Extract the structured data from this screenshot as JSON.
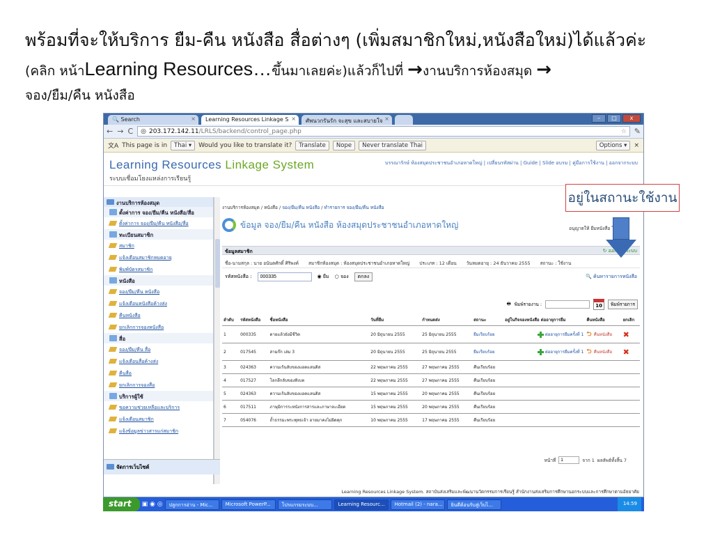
{
  "slide": {
    "line1": "พร้อมที่จะให้บริการ ยืม-คืน หนังสือ สื่อต่างๆ (เพิ่มสมาชิกใหม่,หนังสือใหม่)ได้แล้วค่ะ",
    "line2_a": "(คลิก หน้า",
    "line2_big": "Learning Resources…",
    "line2_b": "ขึ้นมาเลยค่ะ)แล้วก็ไปที่ ",
    "line2_c": "งานบริการห้องสมุด ",
    "line3": "จอง/ยืม/คืน หนังสือ",
    "arrow_glyph": "→"
  },
  "callout": {
    "text": "อยู่ในสถานะใช้งาน",
    "border_color": "#d04040"
  },
  "browser": {
    "tabs": [
      {
        "label": "Search"
      },
      {
        "label": "Learning Resources Linkage S"
      },
      {
        "label": "ศัพนวกรันรัก จะสุข และสบายใจ"
      }
    ],
    "url_host": "203.172.142.11",
    "url_path": "/LRLS/backend/control_page.php",
    "translate": {
      "message": "This page is in",
      "language": "Thai ▾",
      "question": "Would you like to translate it?",
      "translate_btn": "Translate",
      "nope_btn": "Nope",
      "never_btn": "Never translate Thai",
      "options_btn": "Options ▾"
    }
  },
  "app": {
    "title_blue": "Learning Resources ",
    "title_green": "Linkage System",
    "subtitle": "ระบบเชื่อมโยงแหล่งการเรียนรู้",
    "usermenu": "บรรณารักษ์ ห้องสมุดประชาชนอำเภอหาดใหญ่ | เปลี่ยนรหัสผ่าน | Guide | Slide อบรม | คู่มือการใช้งาน | ออกจากระบบ"
  },
  "sidebar": {
    "header": "งานบริการห้องสมุด",
    "items": [
      {
        "type": "sec",
        "label": "ตั้งค่าการ จอง/ยืม/คืน หนังสือ/สื่อ"
      },
      {
        "type": "item",
        "label": "ตั้งค่าการ จอง/ยืม/คืน หนังสือ/สื่อ"
      },
      {
        "type": "sec",
        "label": "ทะเบียนสมาชิก"
      },
      {
        "type": "item",
        "label": "สมาชิก"
      },
      {
        "type": "item",
        "label": "แจ้งเตือนสมาชิกหมดอายุ"
      },
      {
        "type": "item",
        "label": "พิมพ์บัตรสมาชิก"
      },
      {
        "type": "sec",
        "label": "หนังสือ"
      },
      {
        "type": "item",
        "label": "จอง/ยืม/คืน หนังสือ"
      },
      {
        "type": "item",
        "label": "แจ้งเตือนหนังสือค้างส่ง"
      },
      {
        "type": "item",
        "label": "คืนหนังสือ"
      },
      {
        "type": "item",
        "label": "ยกเลิกการจองหนังสือ"
      },
      {
        "type": "sec",
        "label": "สื่อ"
      },
      {
        "type": "item",
        "label": "จอง/ยืม/คืน สื่อ"
      },
      {
        "type": "item",
        "label": "แจ้งเตือนสื่อค้างส่ง"
      },
      {
        "type": "item",
        "label": "คืนสื่อ"
      },
      {
        "type": "item",
        "label": "ยกเลิกการจองสื่อ"
      },
      {
        "type": "sec",
        "label": "บริการผู้ใช้"
      },
      {
        "type": "item",
        "label": "ขอความช่วยเหลือและบริการ"
      },
      {
        "type": "item",
        "label": "แจ้งเตือนสมาชิก"
      },
      {
        "type": "item",
        "label": "แจ้งข้อมูลข่าวสารแก่สมาชิก"
      }
    ],
    "footer": "จัดการเว็บไซต์"
  },
  "main": {
    "crumb_prefix": "งานบริการห้องสมุด / หนังสือ / ",
    "crumb_link1": "จอง/ยืม/คืน หนังสือ",
    "crumb_sep": " / ",
    "crumb_link2": "ทำรายการ จอง/ยืม/คืน หนังสือ",
    "panel_title": "ข้อมูล จอง/ยืม/คืน หนังสือ ห้องสมุดประชาชนอำเภอหาดใหญ่",
    "right_note": "อนุญาตให้ ยืมหนังสือ ได้ไม่เกิน",
    "member_bar": "ข้อมูลสมาชิก",
    "logout": "ออกจากระบบ",
    "info": {
      "name": "ชื่อ-นามสกุล :  นาย อนันตศักดิ์ ศิริพงค์",
      "member": "สมาชิกห้องสมุด : ห้องสมุดประชาชนอำเภอหาดใหญ่",
      "type": "ประเภท : 12 เดือน",
      "expire": "วันหมดอายุ : 24 ธันวาคม 2555",
      "status": "สถานะ : ใช้งาน"
    },
    "search": {
      "label": "รหัสหนังสือ :",
      "value": "000335",
      "opt_borrow": "ยืม",
      "opt_reserve": "จอง",
      "button": "ตกลง",
      "find_books": "ค้นหารายการหนังสือ"
    },
    "print": {
      "label": "พิมพ์รายงาน :",
      "cal": "10",
      "button": "พิมพ์รายการ"
    },
    "table": {
      "headers": [
        "ลำดับ",
        "รหัสหนังสือ",
        "ชื่อหนังสือ",
        "วันที่ยืม",
        "กำหนดส่ง",
        "สถานะ",
        "อยู่ในกิจจองหนังสือ ต่ออายุการยืม",
        "คืนหนังสือ",
        "ยกเลิก"
      ],
      "rows": [
        {
          "no": "1",
          "code": "000335",
          "title": "ตายแล้วยังมีชีวิต",
          "borrow": "20 มิถุนายน 2555",
          "due": "25 มิถุนายน 2555",
          "status": "ยืมเรียบร้อย",
          "renew": "ต่ออายุการยืมครั้งที่ 1",
          "ret": "คืนหนังสือ",
          "del": "✖"
        },
        {
          "no": "2",
          "code": "017545",
          "title": "สามก๊ก เล่ม 3",
          "borrow": "20 มิถุนายน 2555",
          "due": "25 มิถุนายน 2555",
          "status": "ยืมเรียบร้อย",
          "renew": "ต่ออายุการยืมครั้งที่ 1",
          "ret": "คืนหนังสือ",
          "del": "✖"
        },
        {
          "no": "3",
          "code": "024363",
          "title": "ความเร้นลับของแอตแลนติส",
          "borrow": "22 พฤษภาคม 2555",
          "due": "27 พฤษภาคม 2555",
          "status": "คืนเรียบร้อย",
          "renew": "",
          "ret": "",
          "del": ""
        },
        {
          "no": "4",
          "code": "017527",
          "title": "โลกลึกลับของทิเบต",
          "borrow": "22 พฤษภาคม 2555",
          "due": "27 พฤษภาคม 2555",
          "status": "คืนเรียบร้อย",
          "renew": "",
          "ret": "",
          "del": ""
        },
        {
          "no": "5",
          "code": "024363",
          "title": "ความเร้นลับของแอตแลนติส",
          "borrow": "15 พฤษภาคม 2555",
          "due": "20 พฤษภาคม 2555",
          "status": "คืนเรียบร้อย",
          "renew": "",
          "ret": "",
          "del": ""
        },
        {
          "no": "6",
          "code": "017511",
          "title": "ภาษุมิการระหนังการสารและภาษาละเอียด",
          "borrow": "15 พฤษภาคม 2555",
          "due": "20 พฤษภาคม 2555",
          "status": "คืนเรียบร้อย",
          "renew": "",
          "ret": "",
          "del": ""
        },
        {
          "no": "7",
          "code": "054076",
          "title": "ถ้ำธรรมะพระพุทธเจ้า อายมาคงไม่ผิดคุก",
          "borrow": "10 พฤษภาคม 2555",
          "due": "17 พฤษภาคม 2555",
          "status": "คืนเรียบร้อย",
          "renew": "",
          "ret": "",
          "del": ""
        }
      ]
    },
    "paging": {
      "label": "หน้าที่",
      "page": "1",
      "of": "จาก 1",
      "total": "ผลลัพธ์ทั้งสิ้น 7"
    }
  },
  "footer": "Learning Resources Linkage System. สถาบันส่งเสริมและพัฒนานวัตกรรมการเรียนรู้ สำนักงานส่งเสริมการศึกษานอกระบบและการศึกษาตามอัธยาศัย",
  "taskbar": {
    "start": "start",
    "items": [
      "ปลูกการอ่าน - Mic...",
      "Microsoft PowerP...",
      "โปรแกรมระบบ...",
      "Learning Resourc...",
      "Hotmail (2) - nara...",
      "ยินดีต้อนรับสู่เว็บไ..."
    ],
    "clock": "14:59"
  }
}
